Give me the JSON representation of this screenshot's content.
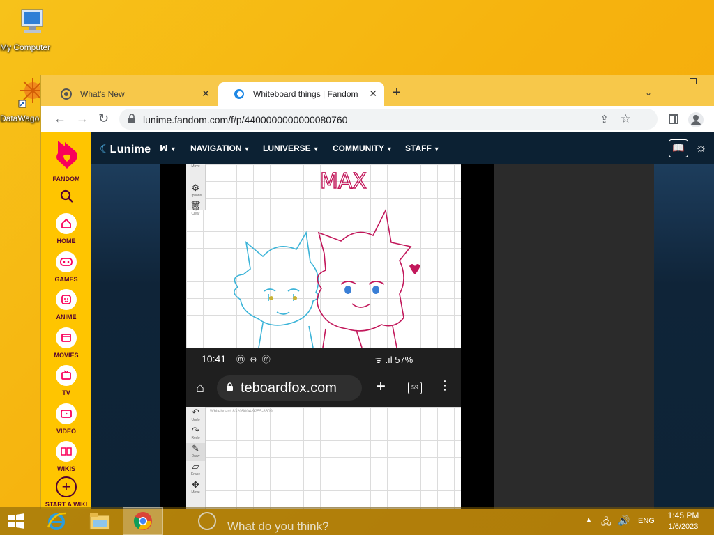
{
  "desktop": {
    "icons": [
      {
        "label": "My Computer"
      },
      {
        "label": "DataWago"
      }
    ]
  },
  "browser": {
    "tabs": [
      {
        "title": "What's New",
        "close": "✕"
      },
      {
        "title": "Whiteboard things | Fandom",
        "close": "✕"
      }
    ],
    "new_tab": "+",
    "tab_menu": "⌄",
    "url": "lunime.fandom.com/f/p/4400000000000080760"
  },
  "fandom_rail": {
    "brand": "FANDOM",
    "items": [
      {
        "label": "HOME"
      },
      {
        "label": "GAMES"
      },
      {
        "label": "ANIME"
      },
      {
        "label": "MOVIES"
      },
      {
        "label": "TV"
      },
      {
        "label": "VIDEO"
      },
      {
        "label": "WIKIS"
      },
      {
        "label": "START A WIKI"
      }
    ]
  },
  "wiki_header": {
    "logo": "Lunime",
    "nav": [
      {
        "label": "NAVIGATION"
      },
      {
        "label": "LUNIVERSE"
      },
      {
        "label": "COMMUNITY"
      },
      {
        "label": "STAFF"
      }
    ]
  },
  "post_image": {
    "drawing_text": "MAX",
    "phone_time": "10:41",
    "phone_battery": "57%",
    "phone_url": "teboardfox.com",
    "phone_tab_count": "59",
    "whiteboard_id": "Whiteboard 83205004-9255-8609",
    "tools_top": [
      {
        "label": "Move"
      },
      {
        "label": "Options"
      },
      {
        "label": "Clear"
      }
    ],
    "tools_bottom": [
      {
        "label": "Undo"
      },
      {
        "label": "Redo"
      },
      {
        "label": "Draw"
      },
      {
        "label": "Erase"
      },
      {
        "label": "Move"
      }
    ]
  },
  "comment": {
    "placeholder": "What do you think?"
  },
  "taskbar": {
    "language": "ENG",
    "time": "1:45 PM",
    "date": "1/6/2023"
  },
  "colors": {
    "fandom_yellow": "#ffc500",
    "fandom_maroon": "#520032",
    "fandom_red": "#fa005a",
    "drawing_cyan": "#3cb4d8",
    "drawing_magenta": "#c2185b"
  }
}
